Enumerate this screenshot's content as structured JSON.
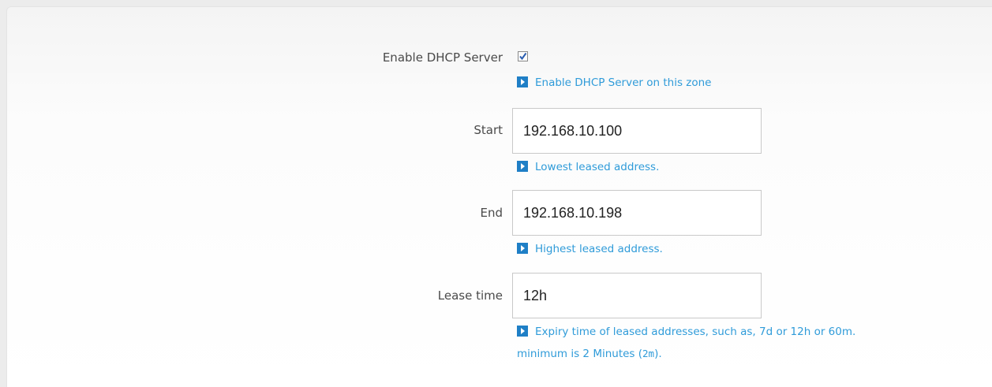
{
  "dhcp": {
    "enable_label": "Enable DHCP Server",
    "enable_checked": true,
    "enable_hint": "Enable DHCP Server on this zone"
  },
  "start": {
    "label": "Start",
    "value": "192.168.10.100",
    "hint": "Lowest leased address."
  },
  "end": {
    "label": "End",
    "value": "192.168.10.198",
    "hint": "Highest leased address."
  },
  "lease": {
    "label": "Lease time",
    "value": "12h",
    "hint": "Expiry time of leased addresses, such as, 7d or 12h or 60m.",
    "hint2_prefix": "minimum is 2 Minutes (",
    "hint2_code": "2m",
    "hint2_suffix": ")."
  },
  "icons": {
    "hint": "play-icon",
    "checkbox": "checkmark-icon"
  },
  "colors": {
    "hint_text": "#2f9bd9",
    "hint_icon": "#1f7fc6"
  }
}
